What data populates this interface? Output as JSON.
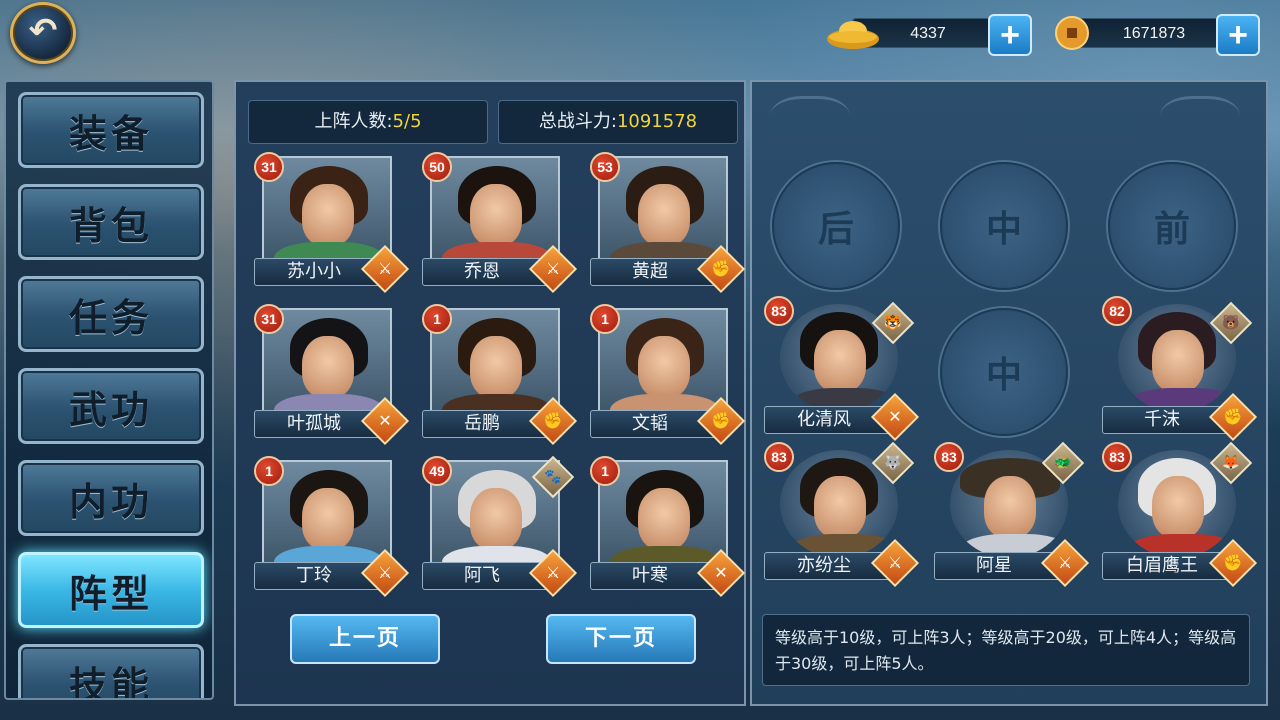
{
  "currency": {
    "gold": {
      "icon": "gold-ingot-icon",
      "value": "4337"
    },
    "coin": {
      "icon": "copper-coin-icon",
      "value": "1671873"
    }
  },
  "sidebar": {
    "items": [
      {
        "label": "装备",
        "active": false
      },
      {
        "label": "背包",
        "active": false
      },
      {
        "label": "任务",
        "active": false
      },
      {
        "label": "武功",
        "active": false
      },
      {
        "label": "内功",
        "active": false
      },
      {
        "label": "阵型",
        "active": true
      },
      {
        "label": "技能",
        "active": false
      }
    ]
  },
  "roster": {
    "count_label": "上阵人数:",
    "count_value": "5/5",
    "power_label": "总战斗力:",
    "power_value": "1091578",
    "heroes": [
      {
        "level": "31",
        "name": "苏小小",
        "type_icon": "sword-icon"
      },
      {
        "level": "50",
        "name": "乔恩",
        "type_icon": "sword-icon"
      },
      {
        "level": "53",
        "name": "黄超",
        "type_icon": "fist-icon"
      },
      {
        "level": "31",
        "name": "叶孤城",
        "type_icon": "crossed-swords-icon"
      },
      {
        "level": "1",
        "name": "岳鹏",
        "type_icon": "fist-icon"
      },
      {
        "level": "1",
        "name": "文韬",
        "type_icon": "fist-icon"
      },
      {
        "level": "1",
        "name": "丁玲",
        "type_icon": "sword-icon"
      },
      {
        "level": "49",
        "name": "阿飞",
        "type_icon": "sword-icon",
        "pet_icon": "beast-icon"
      },
      {
        "level": "1",
        "name": "叶寒",
        "type_icon": "crossed-swords-icon"
      }
    ],
    "prev_label": "上一页",
    "next_label": "下一页"
  },
  "formation": {
    "slot_labels": [
      "后",
      "中",
      "前",
      "中"
    ],
    "heroes": [
      {
        "level": "83",
        "name": "化清风",
        "type_icon": "crossed-swords-icon",
        "pet_icon": "tiger-icon"
      },
      {
        "level": "82",
        "name": "千沫",
        "type_icon": "fist-icon",
        "pet_icon": "bear-icon"
      },
      {
        "level": "83",
        "name": "亦纷尘",
        "type_icon": "sword-icon",
        "pet_icon": "wolf-icon"
      },
      {
        "level": "83",
        "name": "阿星",
        "type_icon": "sword-icon",
        "pet_icon": "beast-icon"
      },
      {
        "level": "83",
        "name": "白眉鹰王",
        "type_icon": "fist-icon",
        "pet_icon": "fox-icon"
      }
    ],
    "info_text": "等级高于10级，可上阵3人；等级高于20级，可上阵4人；等级高于30级，可上阵5人。"
  }
}
